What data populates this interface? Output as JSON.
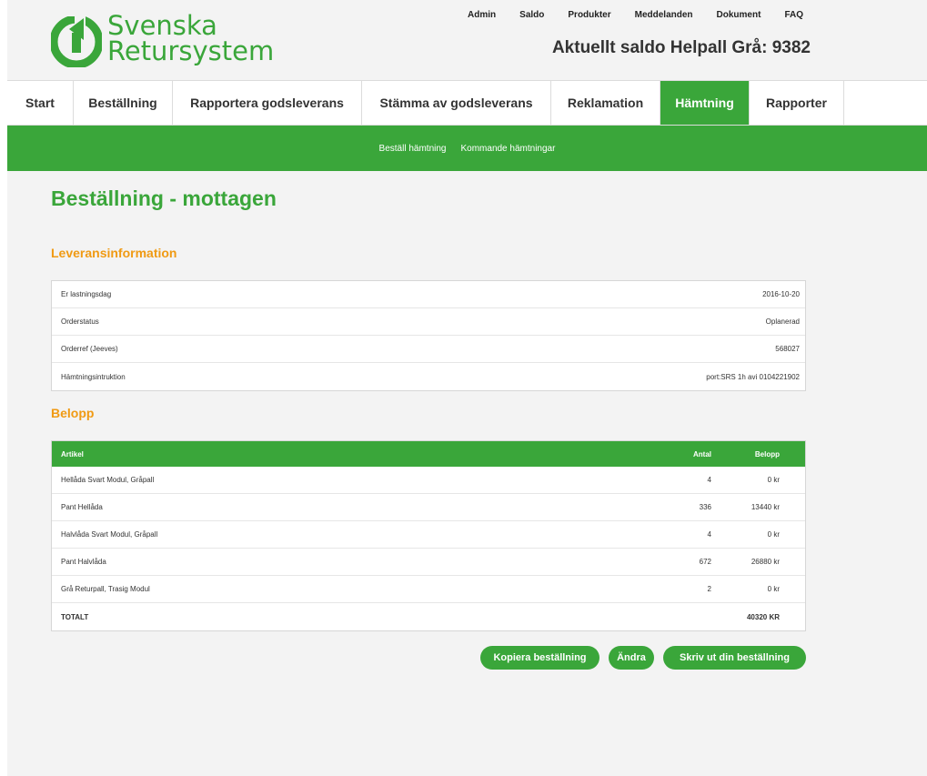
{
  "brand": {
    "line1": "Svenska",
    "line2": "Retursystem",
    "logo_color": "#3aa63a"
  },
  "top_links": [
    "Admin",
    "Saldo",
    "Produkter",
    "Meddelanden",
    "Dokument",
    "FAQ"
  ],
  "saldo_text": "Aktuellt saldo Helpall Grå: 9382",
  "main_nav": [
    {
      "label": "Start",
      "active": false
    },
    {
      "label": "Beställning",
      "active": false
    },
    {
      "label": "Rapportera godsleverans",
      "active": false
    },
    {
      "label": "Stämma av godsleverans",
      "active": false
    },
    {
      "label": "Reklamation",
      "active": false
    },
    {
      "label": "Hämtning",
      "active": true
    },
    {
      "label": "Rapporter",
      "active": false
    }
  ],
  "sub_nav": [
    "Beställ hämtning",
    "Kommande hämtningar"
  ],
  "page_title": "Beställning - mottagen",
  "leverans": {
    "heading": "Leveransinformation",
    "rows": [
      {
        "label": "Er lastningsdag",
        "value": "2016-10-20"
      },
      {
        "label": "Orderstatus",
        "value": "Oplanerad"
      },
      {
        "label": "Orderref (Jeeves)",
        "value": "568027"
      },
      {
        "label": "Hämtningsintruktion",
        "value": "port:SRS 1h avi 0104221902"
      }
    ]
  },
  "belopp": {
    "heading": "Belopp",
    "columns": {
      "artikel": "Artikel",
      "antal": "Antal",
      "belopp": "Belopp"
    },
    "rows": [
      {
        "artikel": "Hellåda Svart Modul, Gråpall",
        "antal": "4",
        "belopp": "0 kr"
      },
      {
        "artikel": "Pant Hellåda",
        "antal": "336",
        "belopp": "13440 kr"
      },
      {
        "artikel": "Halvlåda Svart Modul, Gråpall",
        "antal": "4",
        "belopp": "0 kr"
      },
      {
        "artikel": "Pant Halvlåda",
        "antal": "672",
        "belopp": "26880 kr"
      },
      {
        "artikel": "Grå Returpall, Trasig Modul",
        "antal": "2",
        "belopp": "0 kr"
      }
    ],
    "total_label": "TOTALT",
    "total_value": "40320 KR"
  },
  "buttons": {
    "copy": "Kopiera beställning",
    "edit": "Ändra",
    "print": "Skriv ut din beställning"
  },
  "colors": {
    "green": "#3aa63a",
    "orange": "#f09a13"
  }
}
